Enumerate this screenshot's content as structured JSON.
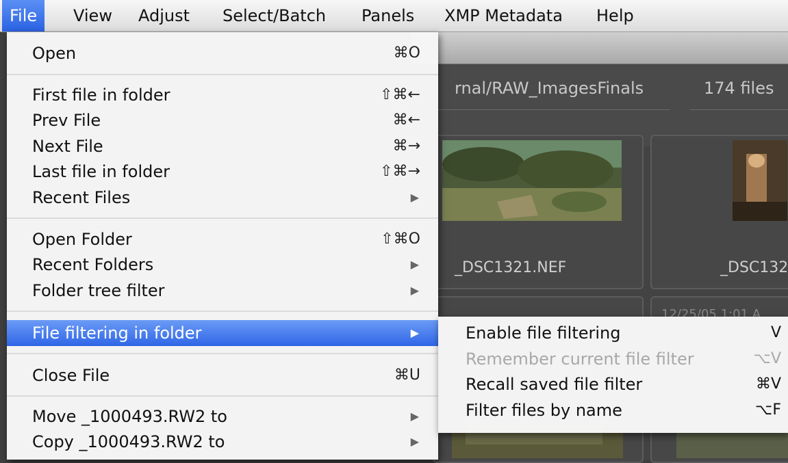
{
  "menubar": {
    "items": [
      "File",
      "View",
      "Adjust",
      "Select/Batch",
      "Panels",
      "XMP Metadata",
      "Help"
    ],
    "active": "File"
  },
  "app": {
    "path": "rnal/RAW_ImagesFinals",
    "file_count": "174 files",
    "thumbs": [
      {
        "name": "_DSC1321.NEF"
      },
      {
        "name": "_DSC132"
      }
    ],
    "date_partial": "12/25/05 1:01 A"
  },
  "menu": {
    "open": {
      "label": "Open",
      "shortcut": "⌘O"
    },
    "first_file": {
      "label": "First file in folder",
      "shortcut": "⇧⌘←"
    },
    "prev_file": {
      "label": "Prev File",
      "shortcut": "⌘←"
    },
    "next_file": {
      "label": "Next File",
      "shortcut": "⌘→"
    },
    "last_file": {
      "label": "Last file in folder",
      "shortcut": "⇧⌘→"
    },
    "recent_files": {
      "label": "Recent Files"
    },
    "open_folder": {
      "label": "Open Folder",
      "shortcut": "⇧⌘O"
    },
    "recent_folders": {
      "label": "Recent Folders"
    },
    "folder_tree_filter": {
      "label": "Folder tree filter"
    },
    "file_filtering": {
      "label": "File filtering in folder"
    },
    "close_file": {
      "label": "Close File",
      "shortcut": "⌘U"
    },
    "move_file": {
      "label": "Move _1000493.RW2 to"
    },
    "copy_file": {
      "label": "Copy _1000493.RW2 to"
    }
  },
  "submenu": {
    "enable": {
      "label": "Enable file filtering",
      "shortcut": "V"
    },
    "remember": {
      "label": "Remember current file filter",
      "shortcut": "⌥V"
    },
    "recall": {
      "label": "Recall saved file filter",
      "shortcut": "⌘V"
    },
    "filter_name": {
      "label": "Filter files by name",
      "shortcut": "⌥F"
    }
  },
  "submenu_arrow_icon": "triangle-right-icon"
}
